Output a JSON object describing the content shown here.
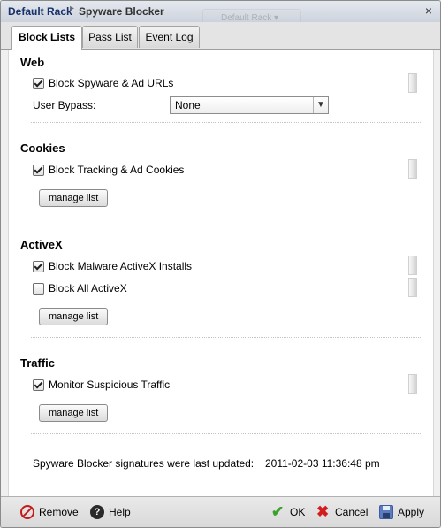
{
  "titlebar": {
    "breadcrumb_parent": "Default Rack",
    "breadcrumb_separator": "▸",
    "breadcrumb_current": "Spyware Blocker",
    "close_glyph": "×",
    "background_ghost_text": "Default Rack ▾"
  },
  "tabs": [
    {
      "label": "Block Lists",
      "active": true
    },
    {
      "label": "Pass List",
      "active": false
    },
    {
      "label": "Event Log",
      "active": false
    }
  ],
  "sections": {
    "web": {
      "title": "Web",
      "block_urls": {
        "label": "Block Spyware & Ad URLs",
        "checked": true
      },
      "user_bypass_label": "User Bypass:",
      "user_bypass_value": "None"
    },
    "cookies": {
      "title": "Cookies",
      "block_cookies": {
        "label": "Block Tracking & Ad Cookies",
        "checked": true
      },
      "manage_label": "manage list"
    },
    "activex": {
      "title": "ActiveX",
      "block_malware": {
        "label": "Block Malware ActiveX Installs",
        "checked": true
      },
      "block_all": {
        "label": "Block All ActiveX",
        "checked": false
      },
      "manage_label": "manage list"
    },
    "traffic": {
      "title": "Traffic",
      "monitor": {
        "label": "Monitor Suspicious Traffic",
        "checked": true
      },
      "manage_label": "manage list"
    }
  },
  "signatures": {
    "label": "Spyware Blocker signatures were last updated:",
    "value": "2011-02-03 11:36:48 pm"
  },
  "footer": {
    "remove_label": "Remove",
    "help_label": "Help",
    "ok_label": "OK",
    "cancel_label": "Cancel",
    "apply_label": "Apply"
  },
  "icons": {
    "remove": "remove-icon",
    "help": "help-icon",
    "ok": "checkmark-icon",
    "cancel": "x-icon",
    "apply": "save-disk-icon"
  },
  "colors": {
    "title_text": "#17326b",
    "ok_green": "#3aa12a",
    "cancel_red": "#d31d1d",
    "remove_red": "#c31b1b"
  }
}
